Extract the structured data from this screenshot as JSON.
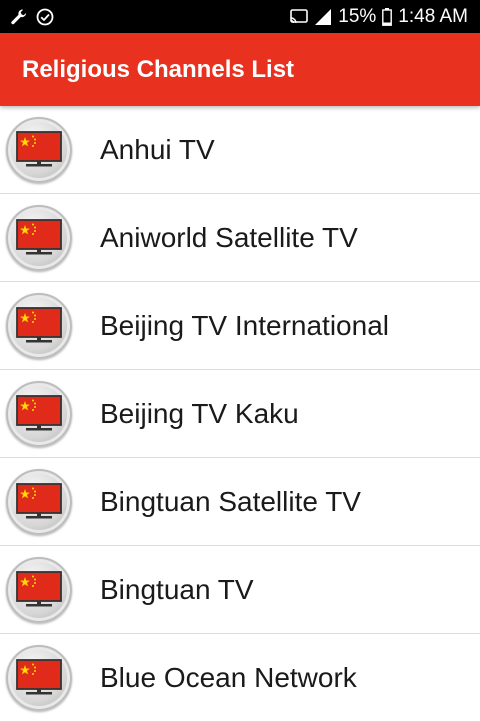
{
  "status_bar": {
    "left_icons": [
      "wrench-icon",
      "check-circle-icon"
    ],
    "right_icons": [
      "cast-icon",
      "signal-icon",
      "battery-icon"
    ],
    "battery": "15%",
    "time": "1:48 AM"
  },
  "app_bar": {
    "title": "Religious Channels List",
    "color": "#e8321f"
  },
  "channels": [
    {
      "name": "Anhui TV",
      "icon": "china-flag-tv-icon"
    },
    {
      "name": "Aniworld Satellite TV",
      "icon": "china-flag-tv-icon"
    },
    {
      "name": "Beijing TV International",
      "icon": "china-flag-tv-icon"
    },
    {
      "name": "Beijing TV Kaku",
      "icon": "china-flag-tv-icon"
    },
    {
      "name": "Bingtuan Satellite TV",
      "icon": "china-flag-tv-icon"
    },
    {
      "name": "Bingtuan TV",
      "icon": "china-flag-tv-icon"
    },
    {
      "name": "Blue Ocean Network",
      "icon": "china-flag-tv-icon"
    }
  ]
}
